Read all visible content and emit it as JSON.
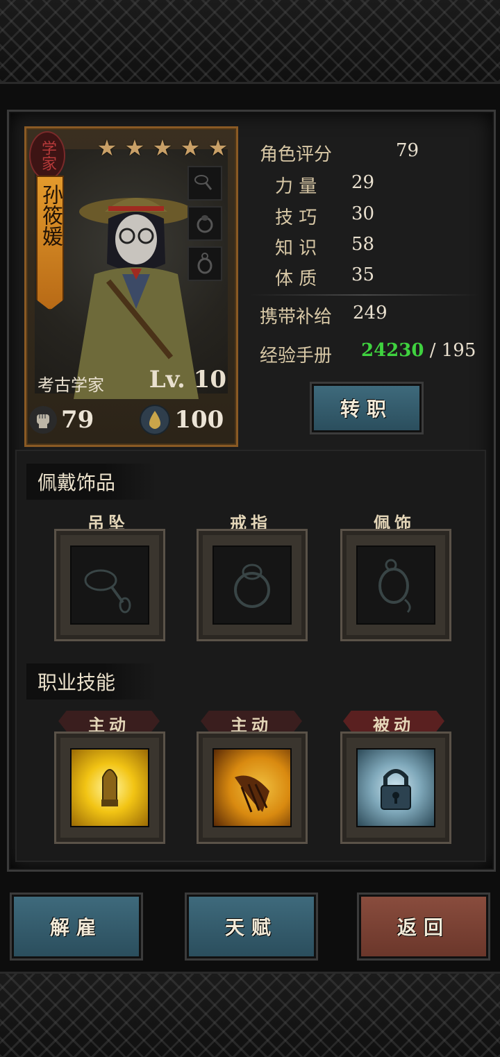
{
  "character": {
    "class_seal": "学家",
    "name": "孙筱媛",
    "class_name": "考古学家",
    "level": "Lv. 10",
    "star_rating": 5,
    "hp": "79",
    "stress": "100"
  },
  "stats": {
    "rating_label": "角色评分",
    "rating_value": "79",
    "strength_label": "力 量",
    "strength_value": "29",
    "skill_label": "技 巧",
    "skill_value": "30",
    "knowledge_label": "知 识",
    "knowledge_value": "58",
    "constitution_label": "体 质",
    "constitution_value": "35",
    "supplies_label": "携带补给",
    "supplies_value": "249",
    "exp_label": "经验手册",
    "exp_current": "24230",
    "exp_sep": " / ",
    "exp_required": "195"
  },
  "buttons": {
    "job_change": "转职",
    "dismiss": "解雇",
    "talent": "天赋",
    "back": "返回"
  },
  "accessories": {
    "title": "佩戴饰品",
    "slots": [
      {
        "label": "吊坠",
        "icon": "pendant-icon"
      },
      {
        "label": "戒指",
        "icon": "ring-icon"
      },
      {
        "label": "佩饰",
        "icon": "charm-icon"
      }
    ]
  },
  "skills": {
    "title": "职业技能",
    "slots": [
      {
        "type": "主动",
        "icon": "bullet-skill-icon"
      },
      {
        "type": "主动",
        "icon": "claw-skill-icon"
      },
      {
        "type": "被动",
        "icon": "lock-skill-icon"
      }
    ]
  },
  "colors": {
    "exp_current": "#3fd23f",
    "button_blue": "#3f6b7d",
    "button_red": "#8a4d3e",
    "card_border": "#8a5a24"
  }
}
